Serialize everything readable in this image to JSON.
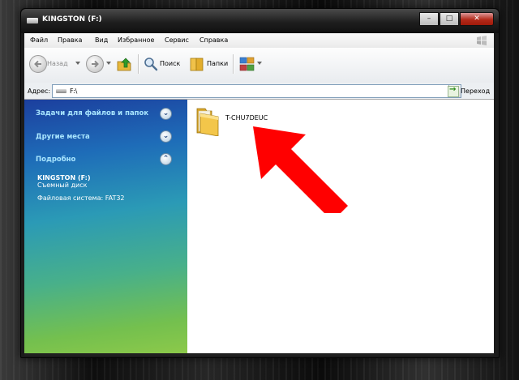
{
  "window": {
    "title": "KINGSTON (F:)",
    "controls": {
      "minimize": "–",
      "maximize": "□",
      "close": "✕"
    }
  },
  "menu": [
    "Файл",
    "Правка",
    "Вид",
    "Избранное",
    "Сервис",
    "Справка"
  ],
  "toolbar": {
    "back_label": "Назад",
    "search_label": "Поиск",
    "folders_label": "Папки"
  },
  "address": {
    "label": "Адрес:",
    "value": "F:\\",
    "go_label": "Переход"
  },
  "sidebar": {
    "sections": [
      {
        "title": "Задачи для файлов и папок",
        "state": "collapsed"
      },
      {
        "title": "Другие места",
        "state": "collapsed"
      },
      {
        "title": "Подробно",
        "state": "expanded"
      }
    ],
    "details": {
      "name": "KINGSTON (F:)",
      "type": "Съемный диск",
      "filesystem": "Файловая система: FAT32"
    }
  },
  "content": {
    "items": [
      {
        "name": "T-CHU7DEUC",
        "icon": "folder-icon"
      }
    ]
  },
  "colors": {
    "arrow": "#ff0000",
    "sidebar_top": "#1c3f9e",
    "sidebar_bottom": "#8cc94a",
    "task_heading": "#a9e6ff"
  }
}
